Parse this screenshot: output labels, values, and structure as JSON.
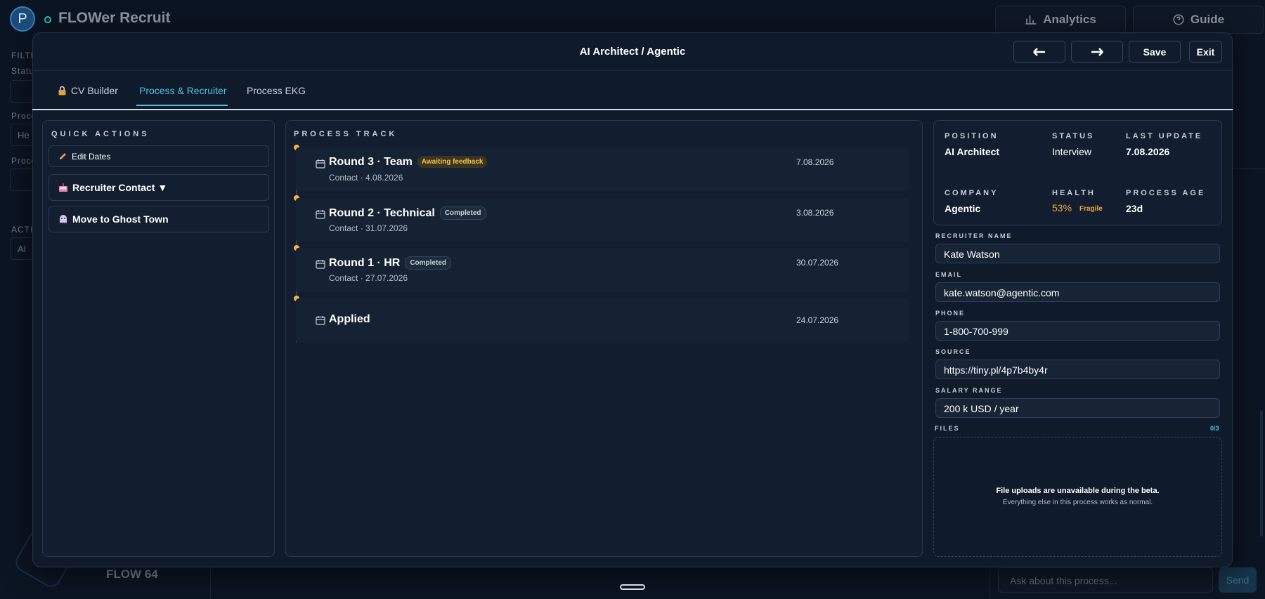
{
  "app": {
    "avatar_letter": "P",
    "title": "FLOWer Recruit",
    "analytics_label": "Analytics",
    "guide_label": "Guide",
    "footer_brand": "FLOW 64",
    "chat_placeholder": "Ask about this process...",
    "send_label": "Send",
    "left_labels": [
      "FILTE",
      "Statu",
      "Proce",
      "Proce",
      "ACTI"
    ],
    "left_values": [
      "He",
      "AI"
    ]
  },
  "modal": {
    "title": "AI Architect / Agentic",
    "prev_icon": "arrow-left-icon",
    "next_icon": "arrow-right-icon",
    "save_label": "Save",
    "exit_label": "Exit",
    "tabs": [
      {
        "label": "CV Builder",
        "icon": "lock-icon"
      },
      {
        "label": "Process & Recruiter",
        "active": true
      },
      {
        "label": "Process EKG"
      }
    ]
  },
  "quick_actions": {
    "title": "QUICK ACTIONS",
    "edit_dates": "Edit Dates",
    "recruiter_contact": "Recruiter Contact ▼",
    "ghost_town": "Move to Ghost Town"
  },
  "process_track": {
    "title": "PROCESS TRACK",
    "rounds": [
      {
        "name": "Round 3 · Team",
        "badge": "Awaiting feedback",
        "contact": "Contact · 4.08.2026",
        "date": "7.08.2026"
      },
      {
        "name": "Round 2 · Technical",
        "badge": "Completed",
        "contact": "Contact · 31.07.2026",
        "date": "3.08.2026"
      },
      {
        "name": "Round 1 · HR",
        "badge": "Completed",
        "contact": "Contact · 27.07.2026",
        "date": "30.07.2026"
      },
      {
        "name": "Applied",
        "badge": "",
        "contact": "",
        "date": "24.07.2026"
      }
    ]
  },
  "summary": {
    "position_label": "POSITION",
    "position": "AI Architect",
    "status_label": "STATUS",
    "status": "Interview",
    "last_update_label": "LAST UPDATE",
    "last_update": "7.08.2026",
    "company_label": "COMPANY",
    "company": "Agentic",
    "health_label": "HEALTH",
    "health": "53%",
    "health_tag": "Fragile",
    "age_label": "PROCESS AGE",
    "age": "23d",
    "colors": {
      "health": "#f3a53c",
      "accent": "#4cc3e6",
      "awaiting": "#f3c24b"
    }
  },
  "recruiter": {
    "name_label": "RECRUITER NAME",
    "name": "Kate Watson",
    "email_label": "EMAIL",
    "email": "kate.watson@agentic.com",
    "phone_label": "PHONE",
    "phone": "1-800-700-999",
    "source_label": "SOURCE",
    "source": "https://tiny.pl/4p7b4by4r",
    "salary_label": "SALARY RANGE",
    "salary": "200 k USD / year"
  },
  "files": {
    "label": "FILES",
    "count": "0/3",
    "notice": "File uploads are unavailable during the beta.",
    "sub": "Everything else in this process works as normal."
  }
}
